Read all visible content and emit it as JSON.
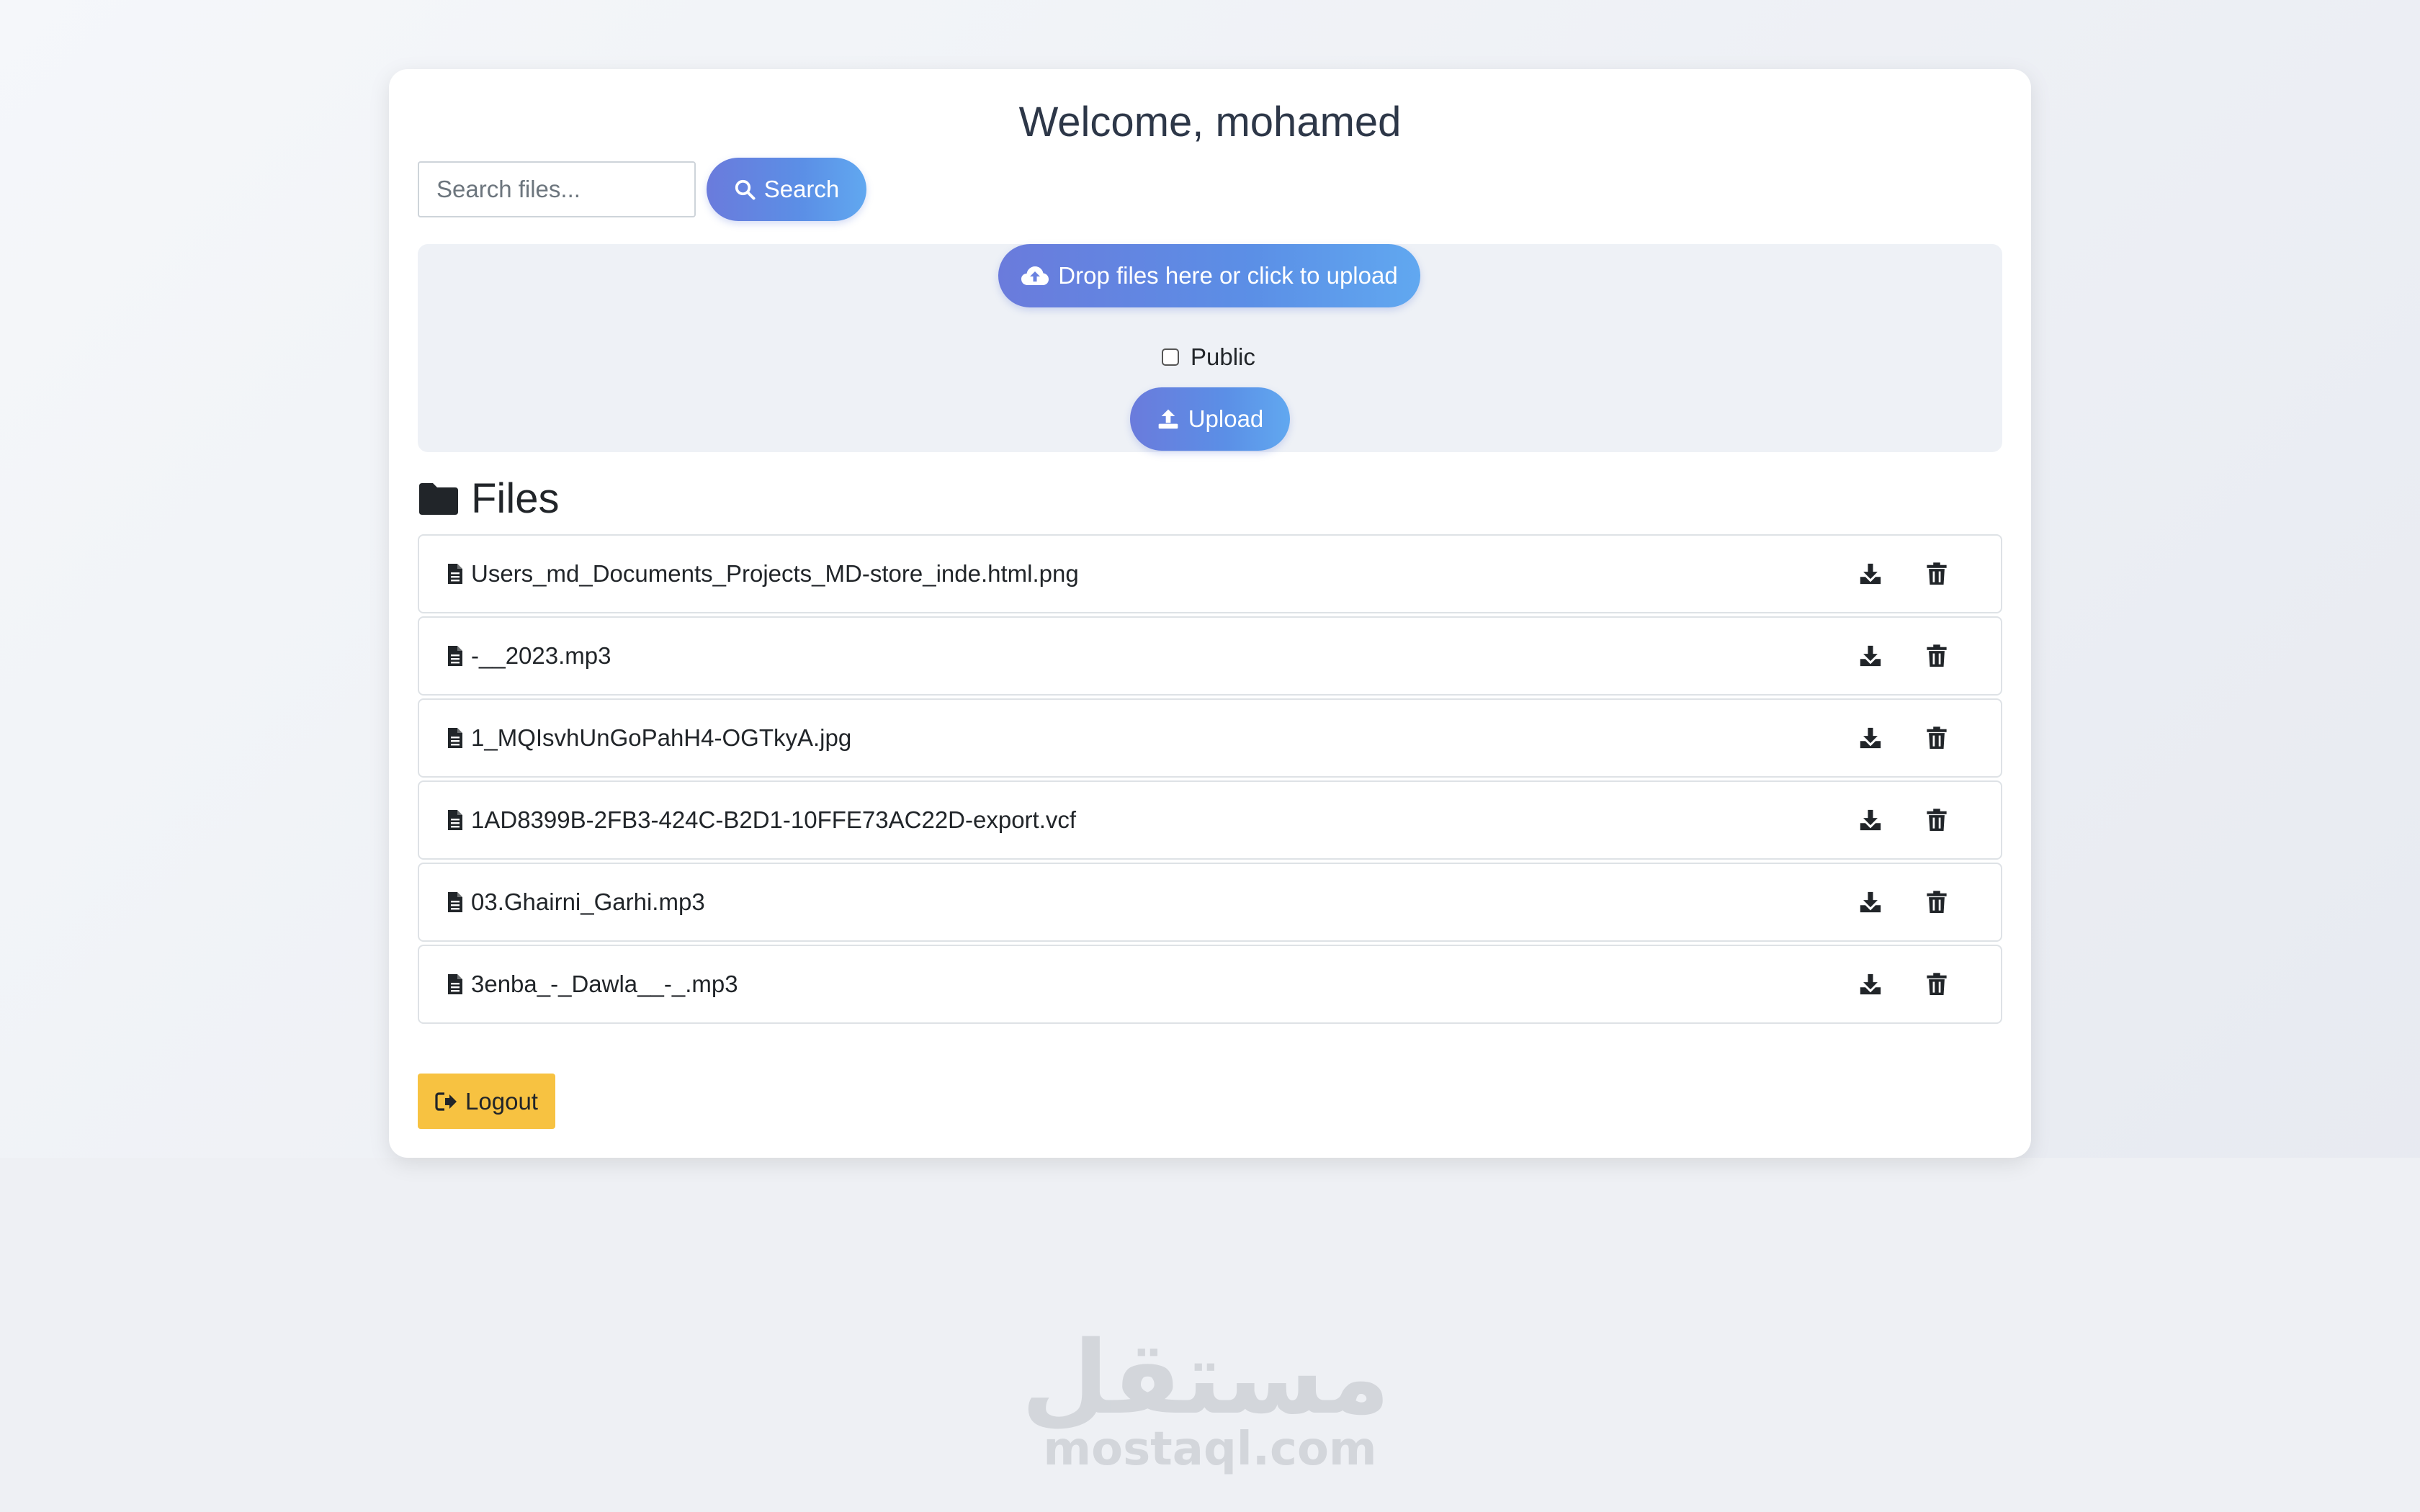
{
  "header": {
    "welcome": "Welcome, mohamed"
  },
  "search": {
    "placeholder": "Search files...",
    "value": "",
    "button_label": "Search",
    "button_icon": "search-icon"
  },
  "upload": {
    "drop_label": "Drop files here or click to upload",
    "drop_icon": "cloud-upload-icon",
    "public_label": "Public",
    "public_checked": false,
    "upload_label": "Upload",
    "upload_icon": "upload-icon"
  },
  "files": {
    "heading": "Files",
    "heading_icon": "folder-icon",
    "items": [
      {
        "name": "Users_md_Documents_Projects_MD-store_inde.html.png"
      },
      {
        "name": "-__2023.mp3"
      },
      {
        "name": "1_MQIsvhUnGoPahH4-OGTkyA.jpg"
      },
      {
        "name": "1AD8399B-2FB3-424C-B2D1-10FFE73AC22D-export.vcf"
      },
      {
        "name": "03.Ghairni_Garhi.mp3"
      },
      {
        "name": "3enba_-_Dawla__-_.mp3"
      }
    ],
    "row_actions": [
      "download-icon",
      "trash-icon"
    ]
  },
  "logout": {
    "label": "Logout",
    "icon": "sign-out-icon",
    "color": "#f7c241"
  },
  "watermark": {
    "arabic": "مستقل",
    "latin": "mostaql.com"
  },
  "colors": {
    "accent_start": "#6a7bdc",
    "accent_end": "#61a8f0",
    "upload_zone_bg": "#eef1f6"
  }
}
